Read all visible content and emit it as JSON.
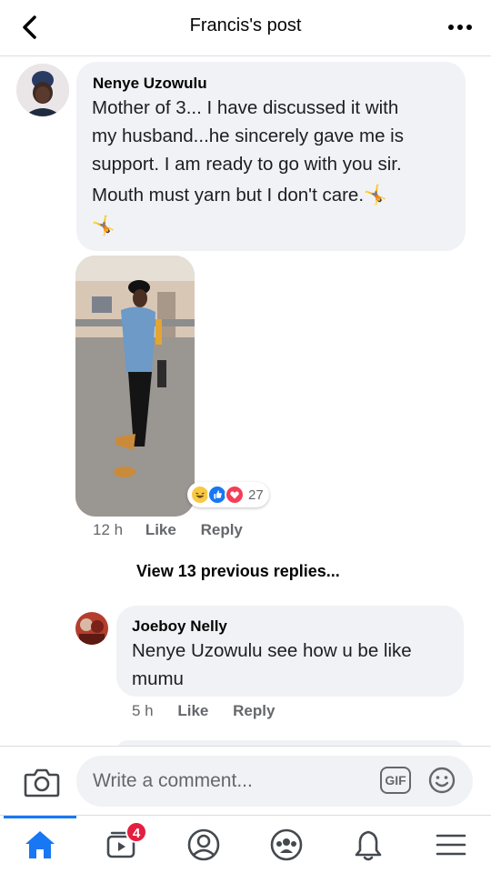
{
  "header": {
    "title": "Francis's post",
    "back_icon": "chevron-left-icon",
    "more_icon": "more-horizontal-icon"
  },
  "comment": {
    "author": "Nenye Uzowulu",
    "lines": [
      "Mother of 3... I have discussed it with",
      "my husband...he sincerely gave me is",
      "support. I am ready to go with you sir.",
      "Mouth must yarn but I don't care.🤸"
    ],
    "emoji_line": "🤸",
    "reaction_count": "27",
    "reactions": [
      "haha",
      "like",
      "love"
    ],
    "time": "12 h",
    "like_label": "Like",
    "reply_label": "Reply"
  },
  "view_previous": "View 13 previous replies...",
  "reply": {
    "author": "Joeboy Nelly",
    "lines": [
      "Nenye Uzowulu see how u be like",
      "mumu"
    ],
    "time": "5 h",
    "like_label": "Like",
    "reply_label": "Reply"
  },
  "composer": {
    "placeholder": "Write a comment...",
    "gif_label": "GIF",
    "camera_icon": "camera-icon",
    "emoji_icon": "smiley-icon"
  },
  "nav": {
    "items": [
      "home-icon",
      "watch-icon",
      "profile-icon",
      "groups-icon",
      "bell-icon",
      "menu-icon"
    ],
    "watch_badge": "4",
    "accent": "#1877f2"
  }
}
